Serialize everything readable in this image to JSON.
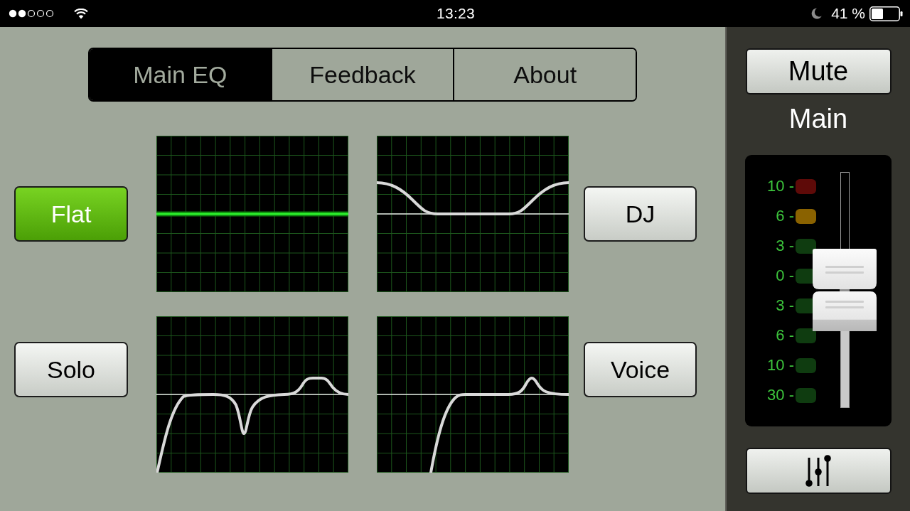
{
  "status_bar": {
    "time": "13:23",
    "battery": "41 %"
  },
  "tabs": [
    {
      "label": "Main EQ",
      "selected": true
    },
    {
      "label": "Feedback",
      "selected": false
    },
    {
      "label": "About",
      "selected": false
    }
  ],
  "presets": [
    {
      "label": "Flat",
      "selected": true,
      "kind": "flat"
    },
    {
      "label": "DJ",
      "selected": false,
      "kind": "shelves"
    },
    {
      "label": "Solo",
      "selected": false,
      "kind": "notch"
    },
    {
      "label": "Voice",
      "selected": false,
      "kind": "peak"
    }
  ],
  "channel": {
    "mute_button": "Mute",
    "name": "Main",
    "meter": [
      {
        "label": "10 -",
        "color": "#5e0a08"
      },
      {
        "label": "6 -",
        "color": "#8a6200"
      },
      {
        "label": "3 -",
        "color": "#0f3c10"
      },
      {
        "label": "0 -",
        "color": "#0f3c10"
      },
      {
        "label": "3 -",
        "color": "#0f3c10"
      },
      {
        "label": "6 -",
        "color": "#0f3c10"
      },
      {
        "label": "10 -",
        "color": "#0f3c10"
      },
      {
        "label": "30 -",
        "color": "#0f3c10"
      }
    ],
    "fader": {
      "level": 0.5
    }
  }
}
